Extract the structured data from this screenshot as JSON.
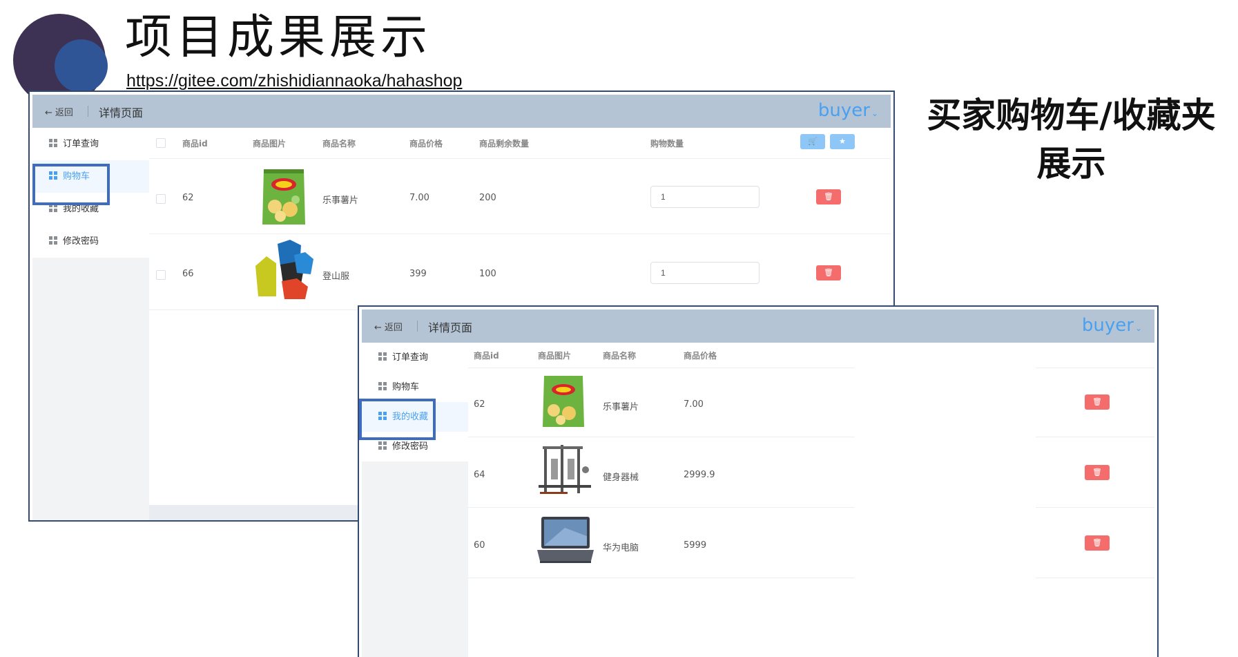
{
  "slide": {
    "title": "项目成果展示",
    "url": "https://gitee.com/zhishidiannaoka/hahashop",
    "caption_line1": "买家购物车/收藏夹",
    "caption_line2": "展示"
  },
  "colors": {
    "header_bg": "#b4c4d5",
    "accent": "#4aa0f0",
    "danger": "#f56c6c",
    "highlight_box": "#3d6cc0"
  },
  "cart_window": {
    "header": {
      "back_label": "返回",
      "back_icon": "arrow-left-icon",
      "title": "详情页面",
      "user": "buyer"
    },
    "sidebar": [
      {
        "label": "订单查询",
        "icon": "grid-icon"
      },
      {
        "label": "购物车",
        "icon": "grid-icon",
        "active": true
      },
      {
        "label": "我的收藏",
        "icon": "grid-icon"
      },
      {
        "label": "修改密码",
        "icon": "grid-icon"
      }
    ],
    "columns": [
      "商品id",
      "商品图片",
      "商品名称",
      "商品价格",
      "商品剩余数量",
      "购物数量"
    ],
    "header_buttons": [
      {
        "icon": "cart-icon",
        "glyph": "🛒"
      },
      {
        "icon": "star-icon",
        "glyph": "★"
      }
    ],
    "rows": [
      {
        "id": "62",
        "image": "chips-bag-image",
        "name": "乐事薯片",
        "price": "7.00",
        "stock": "200",
        "qty": "1",
        "delete_icon": "trash-icon",
        "delete_glyph": "🗑"
      },
      {
        "id": "66",
        "image": "jackets-image",
        "name": "登山服",
        "price": "399",
        "stock": "100",
        "qty": "1",
        "delete_icon": "trash-icon",
        "delete_glyph": "🗑"
      }
    ]
  },
  "favorites_window": {
    "header": {
      "back_label": "返回",
      "back_icon": "arrow-left-icon",
      "title": "详情页面",
      "user": "buyer"
    },
    "sidebar": [
      {
        "label": "订单查询",
        "icon": "grid-icon"
      },
      {
        "label": "购物车",
        "icon": "grid-icon"
      },
      {
        "label": "我的收藏",
        "icon": "grid-icon",
        "active": true
      },
      {
        "label": "修改密码",
        "icon": "grid-icon"
      }
    ],
    "columns": [
      "商品id",
      "商品图片",
      "商品名称",
      "商品价格"
    ],
    "rows": [
      {
        "id": "62",
        "image": "chips-bag-image",
        "name": "乐事薯片",
        "price": "7.00",
        "delete_glyph": "🗑"
      },
      {
        "id": "64",
        "image": "gym-equipment-image",
        "name": "健身器械",
        "price": "2999.9",
        "delete_glyph": "🗑"
      },
      {
        "id": "60",
        "image": "laptop-image",
        "name": "华为电脑",
        "price": "5999",
        "delete_glyph": "🗑"
      }
    ]
  }
}
